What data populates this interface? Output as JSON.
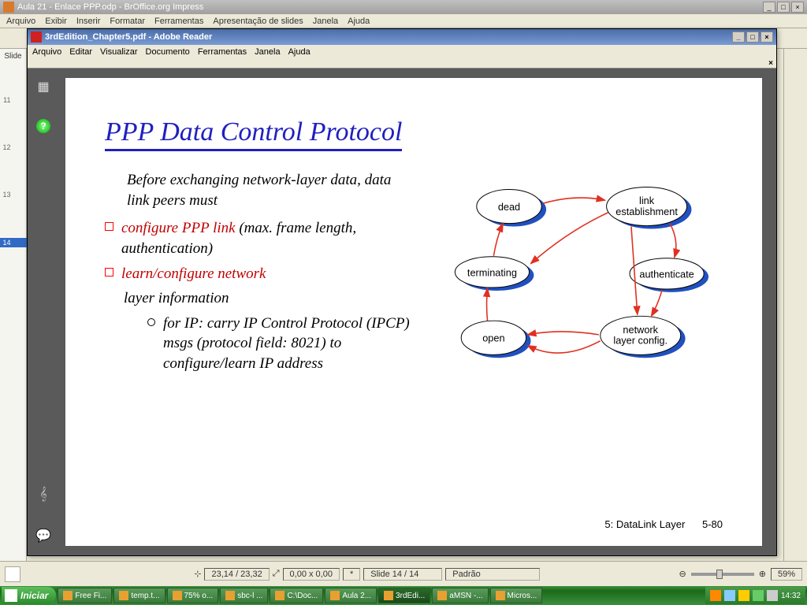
{
  "impress": {
    "title": "Aula 21 - Enlace PPP.odp - BrOffice.org Impress",
    "menu": [
      "Arquivo",
      "Exibir",
      "Inserir",
      "Formatar",
      "Ferramentas",
      "Apresentação de slides",
      "Janela",
      "Ajuda"
    ],
    "panel_header": "Slide",
    "thumbs": [
      "11",
      "12",
      "13",
      "14"
    ],
    "status": {
      "pos": "23,14 / 23,32",
      "size": "0,00 x 0,00",
      "star": "*",
      "slide": "Slide 14 / 14",
      "style": "Padrão",
      "zoom": "59%"
    }
  },
  "adobe": {
    "title": "3rdEdition_Chapter5.pdf - Adobe Reader",
    "menu": [
      "Arquivo",
      "Editar",
      "Visualizar",
      "Documento",
      "Ferramentas",
      "Janela",
      "Ajuda"
    ]
  },
  "slide": {
    "title": "PPP Data Control Protocol",
    "intro": "Before exchanging network-layer data, data link peers must",
    "b1_red": "configure PPP link",
    "b1_rest": " (max. frame length, authentication)",
    "b2_red": "learn/configure network",
    "b2_rest": "layer information",
    "sub": "for IP: carry IP Control Protocol (IPCP) msgs (protocol field: 8021) to configure/learn IP address",
    "footer_left": "5: DataLink Layer",
    "footer_right": "5-80",
    "nodes": {
      "dead": "dead",
      "link": "link establishment",
      "auth": "authenticate",
      "net": "network layer config.",
      "open": "open",
      "term": "terminating"
    }
  },
  "taskbar": {
    "start": "Iniciar",
    "items": [
      "Free Fi...",
      "temp.t...",
      "75% o...",
      "sbc-l ...",
      "C:\\Doc...",
      "Aula 2...",
      "3rdEdi...",
      "aMSN -...",
      "Micros..."
    ],
    "clock": "14:32"
  }
}
